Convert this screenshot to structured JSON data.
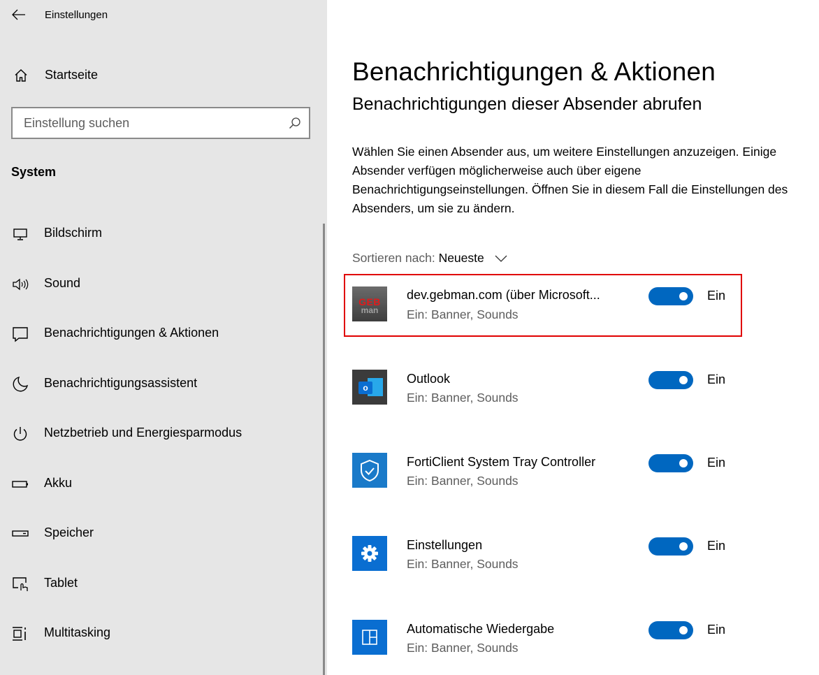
{
  "app": {
    "title": "Einstellungen"
  },
  "sidebar": {
    "home_label": "Startseite",
    "search_placeholder": "Einstellung suchen",
    "section": "System",
    "items": [
      {
        "label": "Bildschirm",
        "icon": "monitor-icon"
      },
      {
        "label": "Sound",
        "icon": "speaker-icon"
      },
      {
        "label": "Benachrichtigungen & Aktionen",
        "icon": "message-icon"
      },
      {
        "label": "Benachrichtigungsassistent",
        "icon": "moon-icon"
      },
      {
        "label": "Netzbetrieb und Energiesparmodus",
        "icon": "power-icon"
      },
      {
        "label": "Akku",
        "icon": "battery-icon"
      },
      {
        "label": "Speicher",
        "icon": "storage-icon"
      },
      {
        "label": "Tablet",
        "icon": "tablet-icon"
      },
      {
        "label": "Multitasking",
        "icon": "multitasking-icon"
      }
    ]
  },
  "main": {
    "title": "Benachrichtigungen & Aktionen",
    "subtitle": "Benachrichtigungen dieser Absender abrufen",
    "description": "Wählen Sie einen Absender aus, um weitere Einstellungen anzuzeigen. Einige Absender verfügen möglicherweise auch über eigene Benachrichtigungseinstellungen. Öffnen Sie in diesem Fall die Einstellungen des Absenders, um sie zu ändern.",
    "sort_label": "Sortieren nach:",
    "sort_value": "Neueste",
    "senders": [
      {
        "name": "dev.gebman.com (über Microsoft...",
        "detail": "Ein: Banner, Sounds",
        "state": "Ein",
        "on": true,
        "icon": "gebman-logo-icon",
        "icon_text_top": "GEB",
        "icon_text_bottom": "man"
      },
      {
        "name": "Outlook",
        "detail": "Ein: Banner, Sounds",
        "state": "Ein",
        "on": true,
        "icon": "outlook-icon",
        "icon_text": "o"
      },
      {
        "name": "FortiClient System Tray Controller",
        "detail": "Ein: Banner, Sounds",
        "state": "Ein",
        "on": true,
        "icon": "shield-check-icon"
      },
      {
        "name": "Einstellungen",
        "detail": "Ein: Banner, Sounds",
        "state": "Ein",
        "on": true,
        "icon": "gear-icon"
      },
      {
        "name": "Automatische Wiedergabe",
        "detail": "Ein: Banner, Sounds",
        "state": "Ein",
        "on": true,
        "icon": "autoplay-icon"
      }
    ]
  },
  "colors": {
    "accent": "#0067c0",
    "sidebar_bg": "#e6e6e6",
    "highlight": "#e00000",
    "secondary_text": "#5d5d5d"
  }
}
